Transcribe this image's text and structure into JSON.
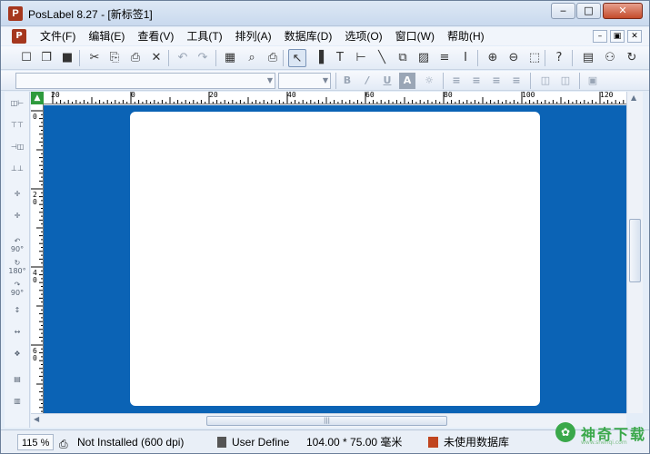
{
  "window": {
    "title": "PosLabel 8.27 - [新标签1]",
    "min_glyph": "‒",
    "max_glyph": "□",
    "close_glyph": "✕"
  },
  "menu": {
    "items": [
      {
        "label": "文件(F)"
      },
      {
        "label": "编辑(E)"
      },
      {
        "label": "查看(V)"
      },
      {
        "label": "工具(T)"
      },
      {
        "label": "排列(A)"
      },
      {
        "label": "数据库(D)"
      },
      {
        "label": "选项(O)"
      },
      {
        "label": "窗口(W)"
      },
      {
        "label": "帮助(H)"
      }
    ],
    "mdi_min": "–",
    "mdi_restore": "▣",
    "mdi_close": "✕"
  },
  "toolbar": {
    "icons": [
      {
        "name": "new-icon",
        "glyph": "☐"
      },
      {
        "name": "open-icon",
        "glyph": "❐"
      },
      {
        "name": "save-icon",
        "glyph": "■"
      },
      {
        "name": "cut-icon",
        "glyph": "✂"
      },
      {
        "name": "copy-icon",
        "glyph": "⎘"
      },
      {
        "name": "paste-icon",
        "glyph": "⎙"
      },
      {
        "name": "delete-icon",
        "glyph": "✕"
      },
      {
        "name": "undo-icon",
        "glyph": "↶"
      },
      {
        "name": "redo-icon",
        "glyph": "↷"
      },
      {
        "name": "label-setup-icon",
        "glyph": "▦"
      },
      {
        "name": "print-preview-icon",
        "glyph": "⌕"
      },
      {
        "name": "print-icon",
        "glyph": "⎙"
      },
      {
        "name": "select-pointer-icon",
        "glyph": "↖"
      },
      {
        "name": "barcode-icon",
        "glyph": "▐"
      },
      {
        "name": "text-icon",
        "glyph": "T"
      },
      {
        "name": "line-tool-icon",
        "glyph": "⊢"
      },
      {
        "name": "diagonal-line-icon",
        "glyph": "╲"
      },
      {
        "name": "shape-icon",
        "glyph": "⧉"
      },
      {
        "name": "image-icon",
        "glyph": "▨"
      },
      {
        "name": "rfid-icon",
        "glyph": "≡"
      },
      {
        "name": "cursor-text-icon",
        "glyph": "I"
      },
      {
        "name": "zoom-in-icon",
        "glyph": "⊕"
      },
      {
        "name": "zoom-out-icon",
        "glyph": "⊖"
      },
      {
        "name": "fit-page-icon",
        "glyph": "⬚"
      },
      {
        "name": "help-icon",
        "glyph": "?"
      },
      {
        "name": "database-icon",
        "glyph": "▤"
      },
      {
        "name": "find-icon",
        "glyph": "⚇"
      },
      {
        "name": "refresh-icon",
        "glyph": "↻"
      }
    ]
  },
  "format_toolbar": {
    "font_name": "",
    "font_size": "",
    "bold": "B",
    "italic": "/",
    "underline": "U",
    "text_box": "A"
  },
  "rulers": {
    "horizontal": [
      "20",
      "0",
      "20",
      "40",
      "60",
      "80",
      "100",
      "120"
    ],
    "vertical": [
      "0",
      "20",
      "40",
      "60"
    ]
  },
  "colors": {
    "workspace": "#0b63b5",
    "page": "#ffffff",
    "ruler_corner": "#2e9a3d"
  },
  "scroll": {
    "grip": "|||"
  },
  "status": {
    "zoom": "115 %",
    "printer": "Not Installed (600 dpi)",
    "label_type": "User Define",
    "label_size": "104.00 * 75.00 毫米",
    "database": "未使用数据库"
  },
  "watermark": {
    "text": "神奇下载",
    "sub": "www.shenqi.com"
  }
}
